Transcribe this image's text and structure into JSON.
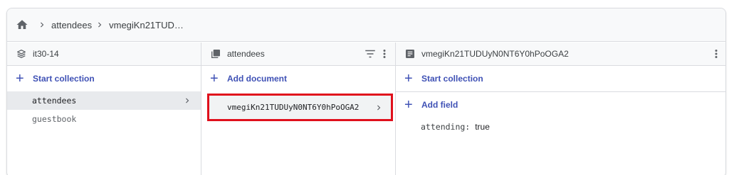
{
  "breadcrumb": {
    "home_icon": "home-icon",
    "items": [
      "attendees",
      "vmegiKn21TUD…"
    ]
  },
  "columns": {
    "project": {
      "icon": "firestore-icon",
      "title": "it30-14",
      "add_label": "Start collection",
      "items": [
        {
          "label": "attendees",
          "selected": true
        },
        {
          "label": "guestbook",
          "selected": false
        }
      ]
    },
    "collection": {
      "icon": "collection-icon",
      "title": "attendees",
      "add_label": "Add document",
      "filter_icon": "filter-icon",
      "more_icon": "more-vert-icon",
      "items": [
        {
          "label": "vmegiKn21TUDUyN0NT6Y0hPoOGA2",
          "selected": true
        }
      ]
    },
    "document": {
      "icon": "document-icon",
      "title": "vmegiKn21TUDUyN0NT6Y0hPoOGA2",
      "more_icon": "more-vert-icon",
      "start_collection_label": "Start collection",
      "add_field_label": "Add field",
      "fields": [
        {
          "key": "attending:",
          "value": "true"
        }
      ]
    }
  },
  "colors": {
    "accent": "#3f51b5",
    "highlight_border": "#e0101c",
    "selected_bg": "#e8eaed"
  }
}
